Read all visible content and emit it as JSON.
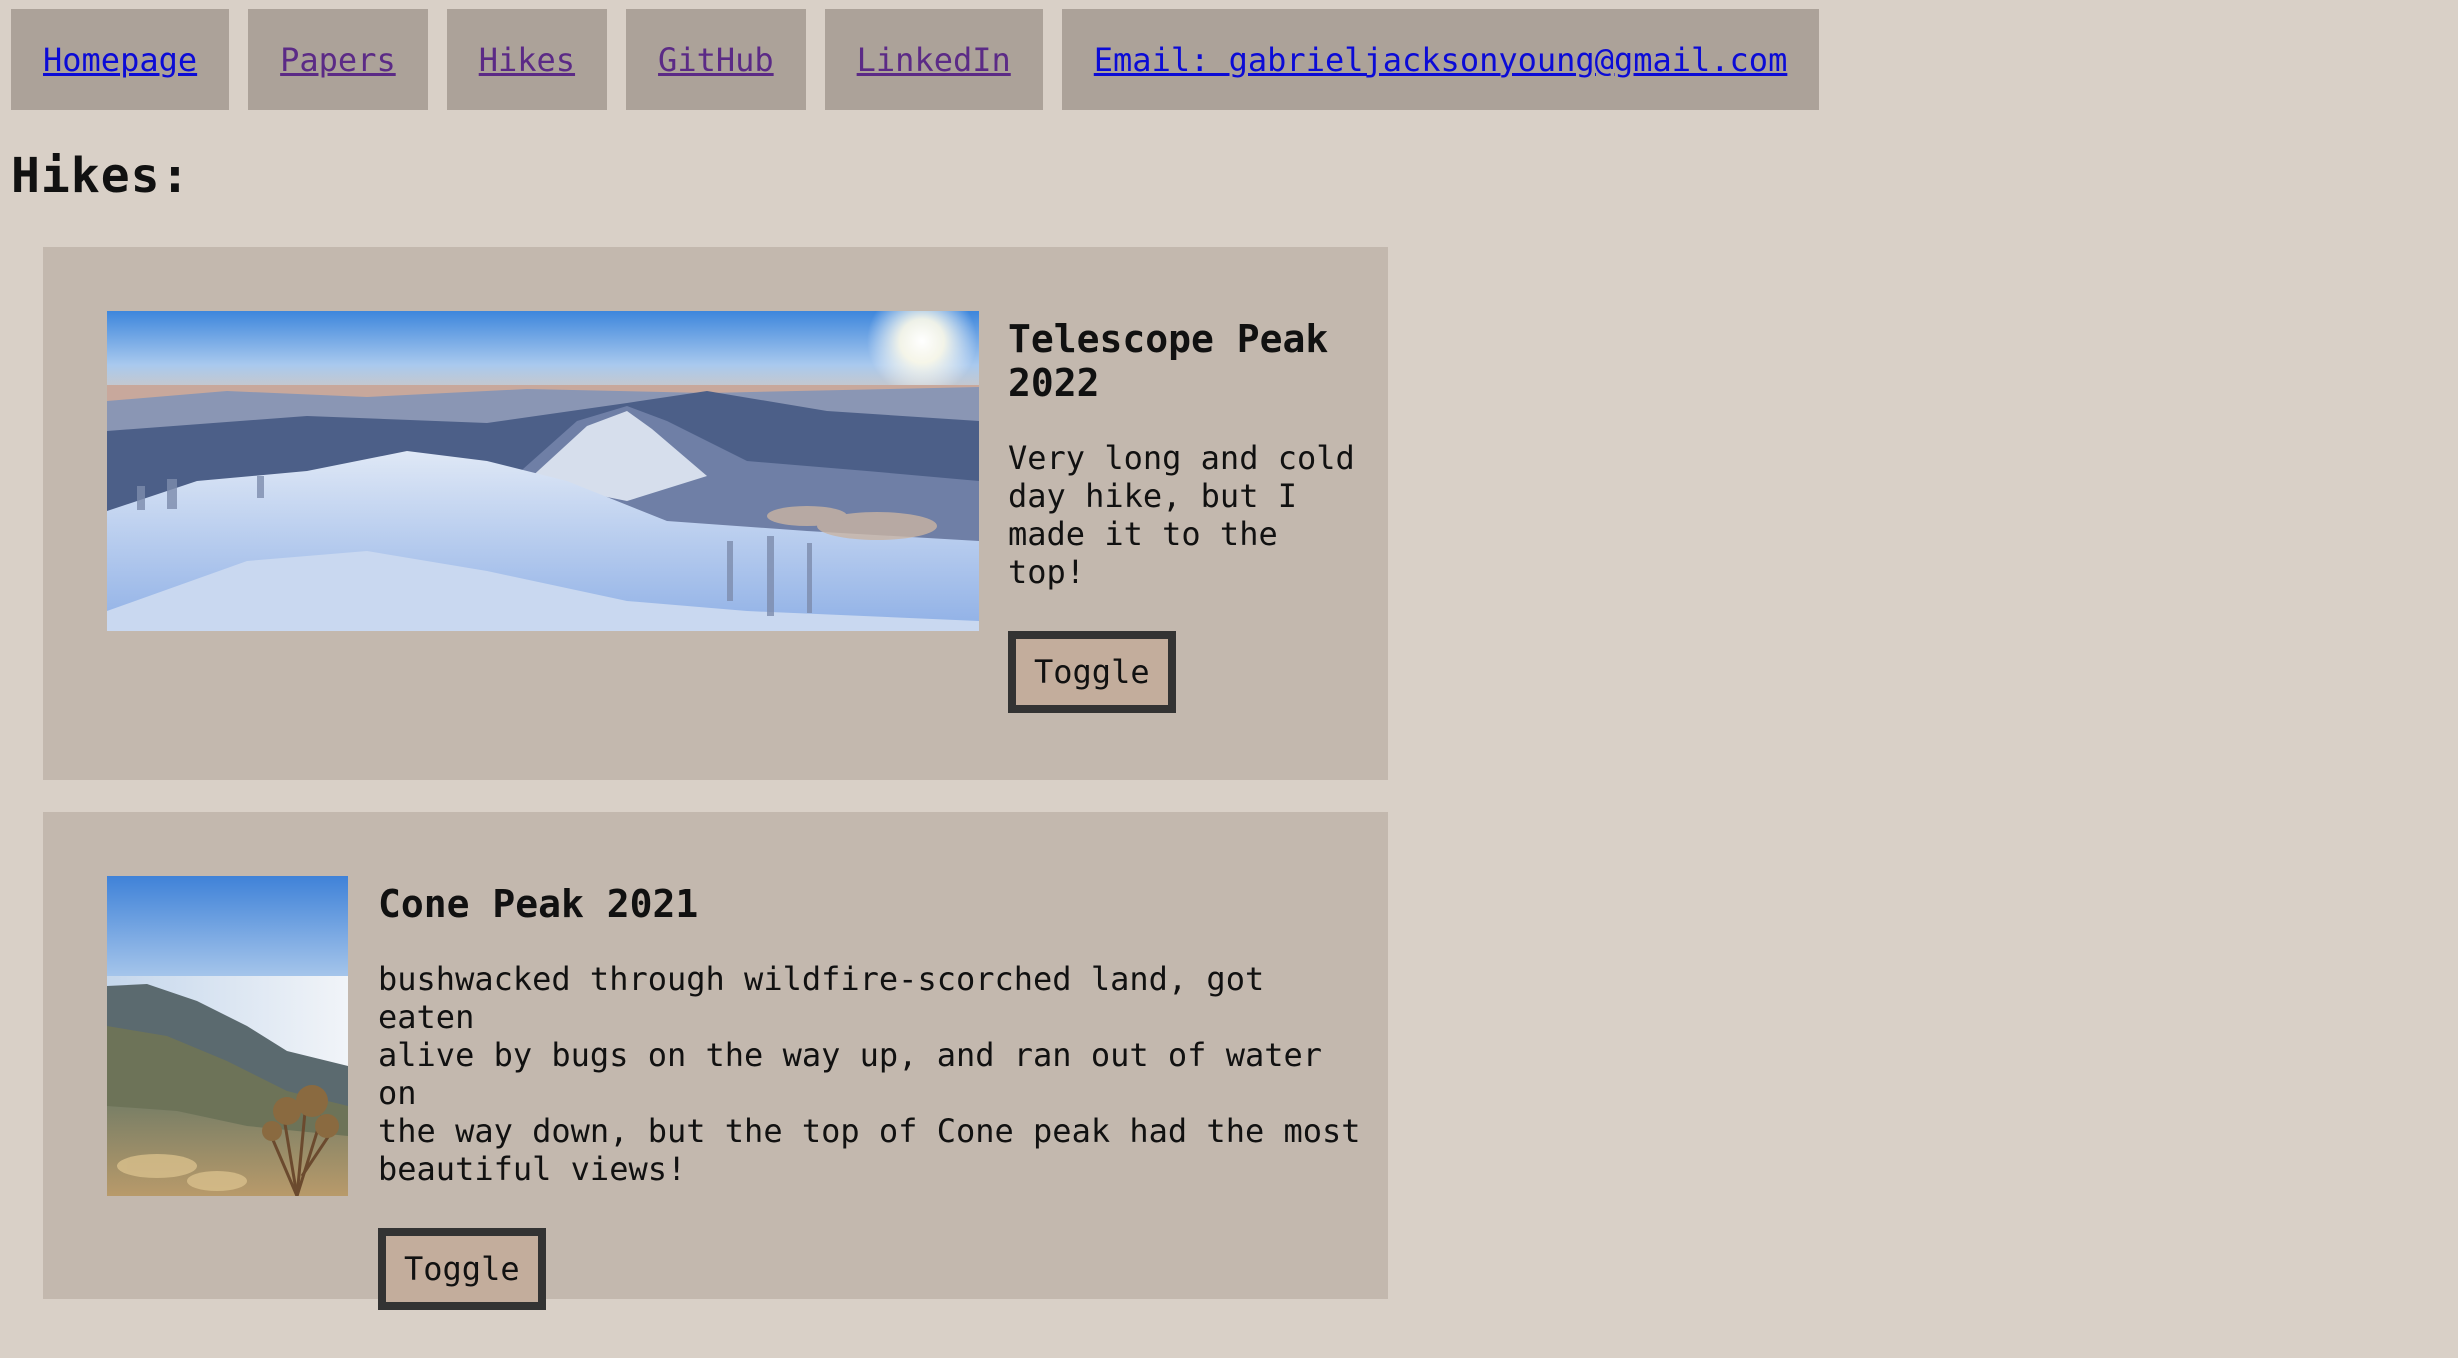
{
  "nav": {
    "items": [
      {
        "label": "Homepage",
        "state": "unvisited"
      },
      {
        "label": "Papers",
        "state": "visited"
      },
      {
        "label": "Hikes",
        "state": "visited"
      },
      {
        "label": "GitHub",
        "state": "visited"
      },
      {
        "label": "LinkedIn",
        "state": "visited"
      },
      {
        "label": "Email: gabrieljacksonyoung@gmail.com",
        "state": "unvisited"
      }
    ]
  },
  "page": {
    "title": "Hikes:"
  },
  "hikes": [
    {
      "title": "Telescope Peak\n2022",
      "description": "Very long and cold\nday hike, but I\nmade it to the\ntop!",
      "toggle_label": "Toggle",
      "photo": "snowy-mountain-ridge-panorama"
    },
    {
      "title": "Cone Peak 2021",
      "description": "bushwacked through wildfire-scorched land, got eaten\nalive by bugs on the way up, and ran out of water on\nthe way down, but the top of Cone peak had the most\nbeautiful views!",
      "toggle_label": "Toggle",
      "photo": "coastal-mountain-view-with-fog"
    }
  ],
  "colors": {
    "background": "#d9d0c7",
    "nav_bg": "#aca299",
    "card_bg": "#c3b8ae",
    "button_bg": "#c3ad9c",
    "button_border": "#333333",
    "link_unvisited": "#0b0bd6",
    "link_visited": "#5b2a86"
  }
}
